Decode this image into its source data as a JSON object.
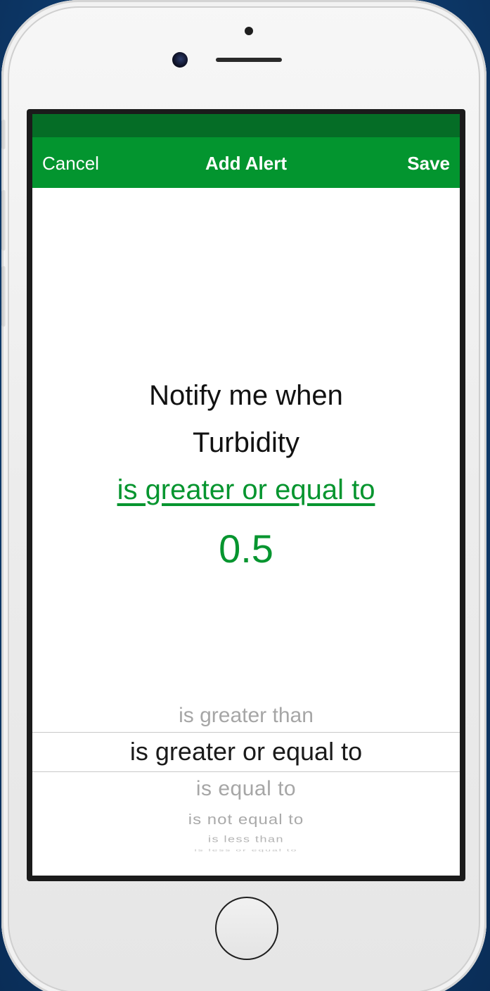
{
  "nav": {
    "cancel_label": "Cancel",
    "title": "Add Alert",
    "save_label": "Save"
  },
  "alert": {
    "intro": "Notify me when",
    "metric": "Turbidity",
    "condition": "is greater or equal to",
    "value": "0.5"
  },
  "picker": {
    "options": [
      "is greater than",
      "is greater or equal to",
      "is equal to",
      "is not equal to",
      "is less than",
      "is less or equal to"
    ],
    "selected": "is greater or equal to"
  },
  "colors": {
    "accent_green": "#03952f",
    "status_bar_green": "#056d26",
    "text_dark": "#111111",
    "picker_muted": "#a6a6a6"
  }
}
